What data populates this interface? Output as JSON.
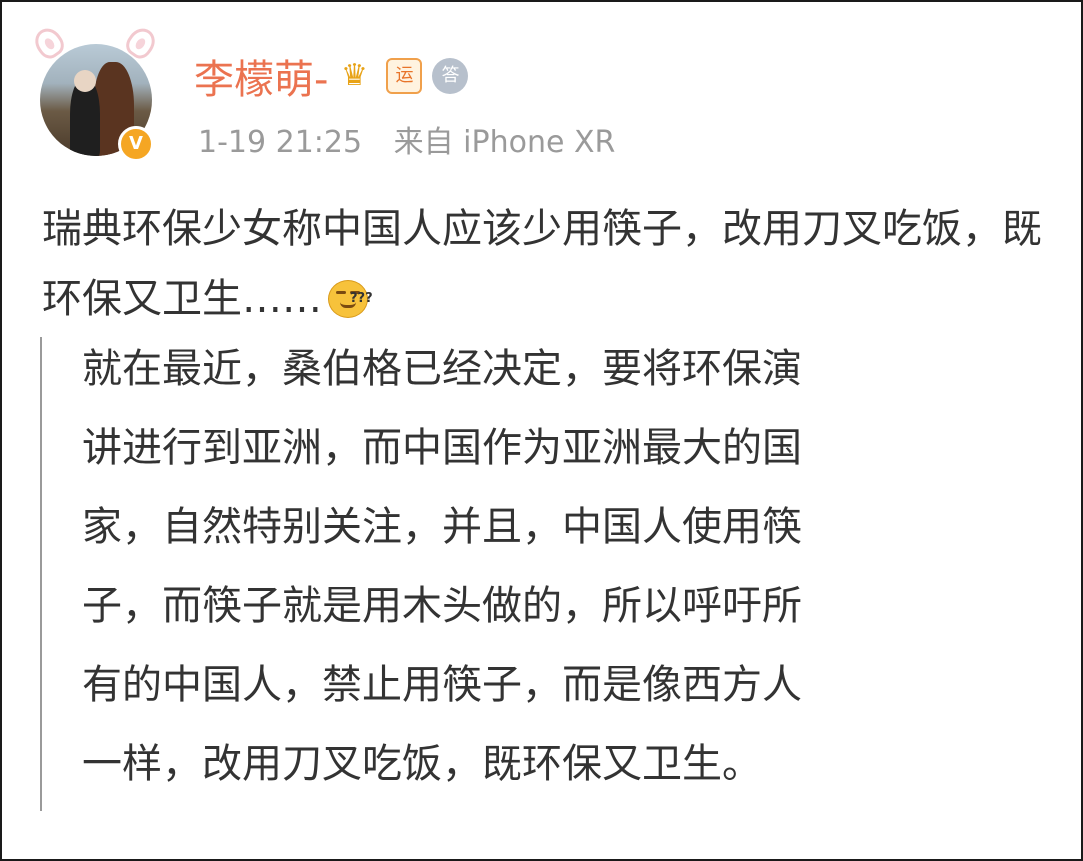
{
  "post": {
    "username": "李檬萌-",
    "badges": {
      "crown": "♛",
      "luck": "运",
      "answer": "答"
    },
    "verified_badge": "V",
    "timestamp": "1-19 21:25",
    "source": "来自 iPhone XR",
    "text": "瑞典环保少女称中国人应该少用筷子，改用刀叉吃饭，既环保又卫生……",
    "emoji_icon": "dizzy-smile-emoji",
    "quote_lines": [
      "就在最近，桑伯格已经决定，要将环保演",
      "讲进行到亚洲，而中国作为亚洲最大的国",
      "家，自然特别关注，并且，中国人使用筷",
      "子，而筷子就是用木头做的，所以呼吁所",
      "有的中国人，禁止用筷子，而是像西方人",
      "一样，改用刀叉吃饭，既环保又卫生。"
    ]
  },
  "colors": {
    "username": "#eb7350",
    "meta": "#9a9a9a",
    "text": "#333333",
    "quote_bar": "#9a9a9a",
    "verified": "#f5a623"
  }
}
